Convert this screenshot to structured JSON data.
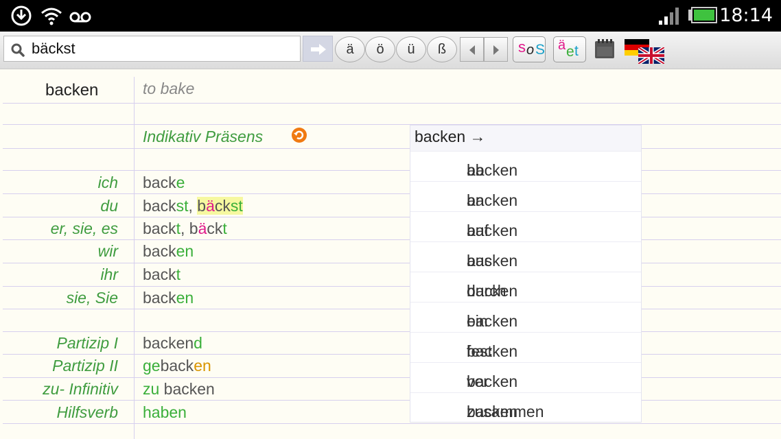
{
  "status": {
    "time": "18:14"
  },
  "search": {
    "query": "bäckst"
  },
  "umlaut_keys": [
    "ä",
    "ö",
    "ü",
    "ß"
  ],
  "verb": {
    "infinitive": "backen",
    "translation": "to bake"
  },
  "tense": {
    "title": "Indikativ Präsens"
  },
  "rows": [
    {
      "label": "ich",
      "parts": [
        "back",
        "e"
      ]
    },
    {
      "label": "du",
      "parts": [
        "back",
        "st",
        ", ",
        "b",
        "ä",
        "ck",
        "st"
      ]
    },
    {
      "label": "er, sie, es",
      "parts": [
        "back",
        "t",
        ", ",
        "b",
        "ä",
        "ck",
        "t"
      ]
    },
    {
      "label": "wir",
      "parts": [
        "back",
        "en"
      ]
    },
    {
      "label": "ihr",
      "parts": [
        "back",
        "t"
      ]
    },
    {
      "label": "sie, Sie",
      "parts": [
        "back",
        "en"
      ]
    },
    {
      "label": "Partizip I",
      "parts": [
        "backen",
        "d"
      ]
    },
    {
      "label": "Partizip II",
      "parts": [
        "ge",
        "back",
        "en"
      ]
    },
    {
      "label": "zu- Infinitiv",
      "parts": [
        "zu",
        " backen"
      ]
    },
    {
      "label": "Hilfsverb",
      "parts": [
        "haben"
      ]
    }
  ],
  "popup": {
    "title": "backen →",
    "items": [
      {
        "prefix": "ab",
        "stem": "backen"
      },
      {
        "prefix": "an",
        "stem": "backen"
      },
      {
        "prefix": "auf",
        "stem": "backen"
      },
      {
        "prefix": "aus",
        "stem": "backen"
      },
      {
        "prefix": "durch",
        "stem": "backen"
      },
      {
        "prefix": "ein",
        "stem": "backen"
      },
      {
        "prefix": "fest",
        "stem": "backen"
      },
      {
        "prefix": "ver",
        "stem": "backen"
      },
      {
        "prefix": "zusammen",
        "stem": "backen"
      }
    ]
  },
  "buttons": {
    "sos": {
      "s1": "s",
      "o": "o",
      "s2": "S"
    },
    "aet": {
      "a": "ä",
      "e": "e",
      "t": "t"
    }
  },
  "colors": {
    "ending": "#3aaf3a",
    "umlaut_change": "#e0198a",
    "prefix": "#a56d6d",
    "label": "#3f9c3f"
  },
  "icons": [
    "download-icon",
    "wifi-icon",
    "voicemail-icon",
    "signal-icon",
    "battery-icon",
    "search-icon",
    "arrow-right-icon",
    "chevron-left-icon",
    "chevron-right-icon",
    "calendar-icon",
    "german-flag-icon",
    "uk-flag-icon",
    "undo-icon"
  ]
}
